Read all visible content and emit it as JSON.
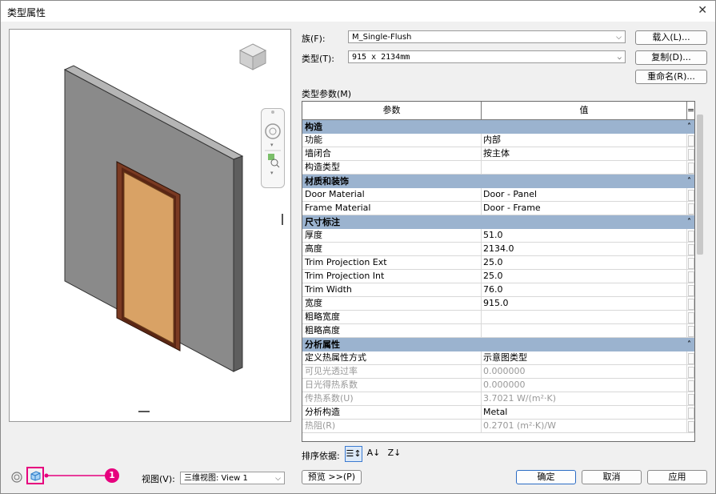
{
  "window": {
    "title": "类型属性",
    "close_glyph": "✕"
  },
  "family": {
    "label": "族(F):",
    "value": "M_Single-Flush",
    "load_button": "载入(L)..."
  },
  "type": {
    "label": "类型(T):",
    "value": "915 x 2134mm",
    "duplicate_button": "复制(D)...",
    "rename_button": "重命名(R)..."
  },
  "params": {
    "title": "类型参数(M)",
    "col_param": "参数",
    "col_value": "值",
    "col_extra": "=",
    "groups": [
      {
        "name": "构造",
        "collapse": "˄",
        "rows": [
          {
            "name": "功能",
            "value": "内部"
          },
          {
            "name": "墙闭合",
            "value": "按主体"
          },
          {
            "name": "构造类型",
            "value": ""
          }
        ]
      },
      {
        "name": "材质和装饰",
        "collapse": "˄",
        "rows": [
          {
            "name": "Door Material",
            "value": "Door - Panel"
          },
          {
            "name": "Frame Material",
            "value": "Door - Frame"
          }
        ]
      },
      {
        "name": "尺寸标注",
        "collapse": "˄",
        "rows": [
          {
            "name": "厚度",
            "value": "51.0"
          },
          {
            "name": "高度",
            "value": "2134.0"
          },
          {
            "name": "Trim Projection Ext",
            "value": "25.0"
          },
          {
            "name": "Trim Projection Int",
            "value": "25.0"
          },
          {
            "name": "Trim Width",
            "value": "76.0"
          },
          {
            "name": "宽度",
            "value": "915.0"
          },
          {
            "name": "粗略宽度",
            "value": ""
          },
          {
            "name": "粗略高度",
            "value": ""
          }
        ]
      },
      {
        "name": "分析属性",
        "collapse": "˄",
        "rows": [
          {
            "name": "定义热属性方式",
            "value": "示意图类型"
          },
          {
            "name": "可见光透过率",
            "value": "0.000000",
            "dim": true
          },
          {
            "name": "日光得热系数",
            "value": "0.000000",
            "dim": true
          },
          {
            "name": "传热系数(U)",
            "value": "3.7021 W/(m²·K)",
            "dim": true
          },
          {
            "name": "分析构造",
            "value": "Metal"
          },
          {
            "name": "热阻(R)",
            "value": "0.2701 (m²·K)/W",
            "dim": true
          }
        ]
      }
    ]
  },
  "sort": {
    "label": "排序依据:"
  },
  "view": {
    "label": "视图(V):",
    "value": "三维视图: View 1",
    "preview_button": "预览 >>(P)"
  },
  "buttons": {
    "ok": "确定",
    "cancel": "取消",
    "apply": "应用"
  },
  "callout": {
    "number": "1",
    "color": "#e6007e"
  },
  "colors": {
    "group_header": "#9bb3cf",
    "door_panel": "#d9a265",
    "door_frame": "#7a3a22",
    "wall_front": "#8a8a8a"
  }
}
